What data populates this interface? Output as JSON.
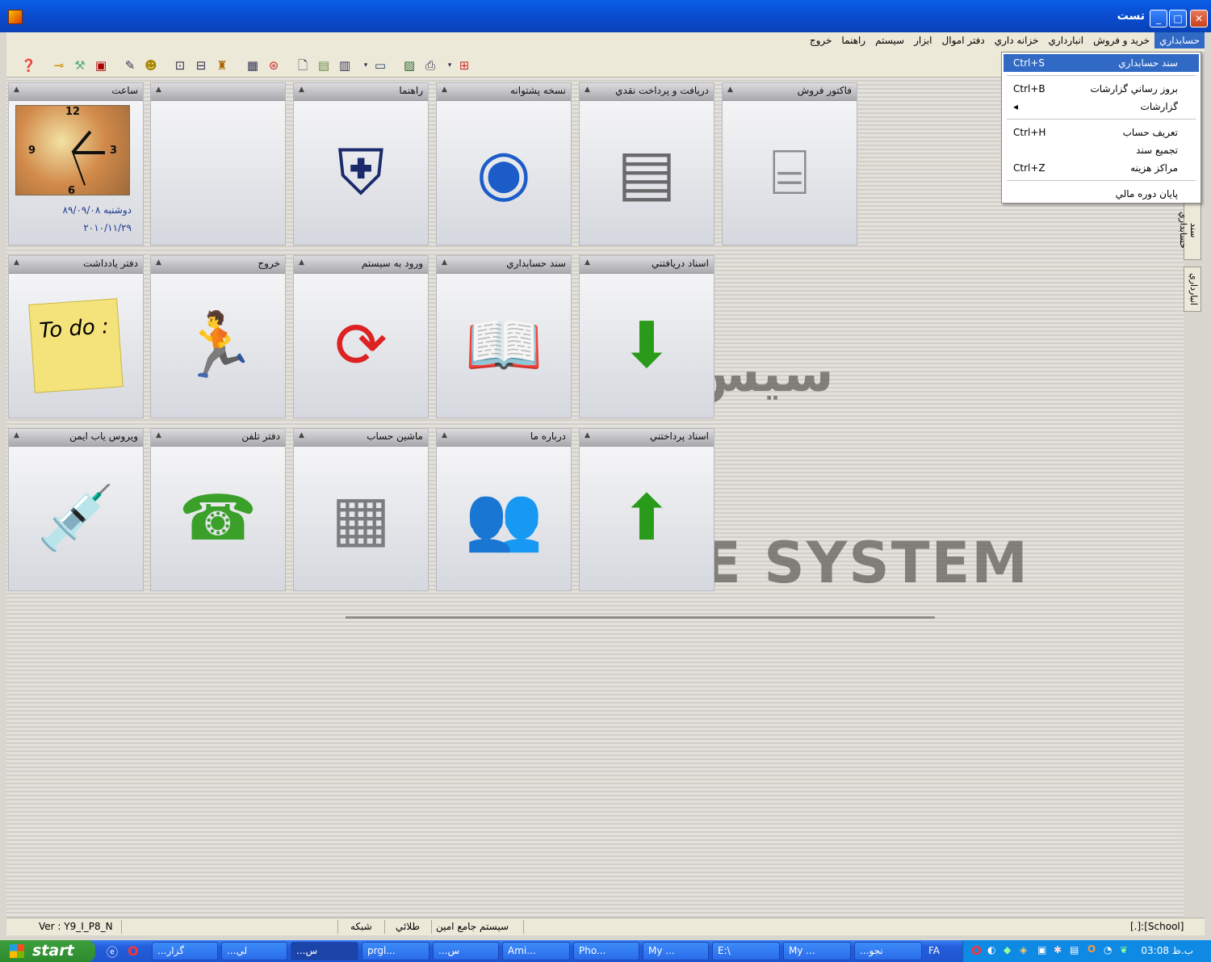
{
  "window": {
    "title": "تست",
    "min_glyph": "_",
    "max_glyph": "□",
    "close_glyph": "✕"
  },
  "menu": {
    "items": [
      "حسابداري",
      "خريد و فروش",
      "انبارداري",
      "خزانه داري",
      "دفتر اموال",
      "ابزار",
      "سيستم",
      "راهنما",
      "خروج"
    ],
    "active": "حسابداري"
  },
  "dropdown": {
    "items": [
      {
        "label": "سند حسابداري",
        "shortcut": "Ctrl+S",
        "highlight": true
      },
      {
        "label": "بروز رساني گزارشات",
        "shortcut": "Ctrl+B"
      },
      {
        "label": "گزارشات",
        "shortcut": "◂"
      },
      {
        "label": "تعريف حساب",
        "shortcut": "Ctrl+H"
      },
      {
        "label": "تجميع سند",
        "shortcut": ""
      },
      {
        "label": "مراكز هزينه",
        "shortcut": "Ctrl+Z"
      },
      {
        "label": "پايان دوره مالي",
        "shortcut": ""
      }
    ]
  },
  "side_tabs": [
    "سند حسابداري",
    "انبارداري"
  ],
  "tiles": {
    "row1": [
      "ساعت",
      "",
      "راهنما",
      "نسخه پشتوانه",
      "دريافت و پرداخت نقدي",
      "فاكتور فروش"
    ],
    "row2": [
      "دفتر يادداشت",
      "خروج",
      "ورود به سيستم",
      "سند حسابداري",
      "اسناد دريافتني"
    ],
    "row3": [
      "ويروس ياب ايمن",
      "دفتر تلفن",
      "ماشين حساب",
      "درباره ما",
      "اسناد پرداختني"
    ]
  },
  "clock": {
    "n12": "12",
    "n3": "3",
    "n6": "6",
    "n9": "9",
    "date_fa": "دوشنبه ۸۹/۰۹/۰۸",
    "date_en": "۲۰۱۰/۱۱/۲۹"
  },
  "watermark": {
    "line1": "سيس",
    "line2": "E SYSTEM"
  },
  "statusbar": {
    "version": "Ver : Y9_I_P8_N",
    "network": "شبکه",
    "edition": "طلائي",
    "system": "سيستم جامع امين",
    "school": "[.]:[School]"
  },
  "taskbar": {
    "start": "start",
    "buttons": [
      "...گزار",
      "...لي",
      "...س",
      "prgl...",
      "...س",
      "Ami...",
      "Pho...",
      "My ...",
      "E:\\",
      "My ...",
      "...نجو"
    ],
    "lang": "FA",
    "time": "03:08 ب.ظ"
  },
  "colors": {
    "accent": "#316ac5",
    "titlebar": "#0a4fd4",
    "taskbar": "#245edb",
    "start": "#2d8a2d"
  }
}
